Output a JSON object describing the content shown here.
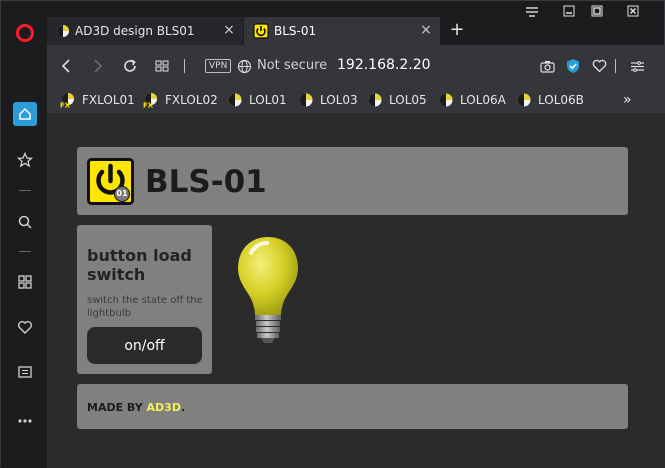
{
  "tabs": [
    {
      "title": "AD3D design BLS01",
      "active": false
    },
    {
      "title": "BLS-01",
      "active": true
    }
  ],
  "address_bar": {
    "vpn_label": "VPN",
    "security_text": "Not secure",
    "url": "192.168.2.20"
  },
  "bookmarks": [
    {
      "label": "FXLOL01",
      "icon": "fx-favicon"
    },
    {
      "label": "FXLOL02",
      "icon": "fx-favicon"
    },
    {
      "label": "LOL01",
      "icon": "lol-favicon"
    },
    {
      "label": "LOL03",
      "icon": "lol-favicon"
    },
    {
      "label": "LOL05",
      "icon": "lol-favicon"
    },
    {
      "label": "LOL06A",
      "icon": "lol-favicon"
    },
    {
      "label": "LOL06B",
      "icon": "lol-favicon"
    }
  ],
  "page": {
    "title": "BLS-01",
    "logo_badge": "01",
    "switch_card": {
      "title": "button load switch",
      "description": "switch the state off the lightbulb",
      "button_label": "on/off"
    },
    "footer": {
      "prefix": "MADE BY ",
      "brand": "AD3D",
      "suffix": "."
    }
  },
  "colors": {
    "accent_yellow": "#ffe600",
    "brand_yellow": "#f5f05a",
    "card_gray": "#808080",
    "page_bg": "#2b2b2b",
    "opera_red": "#ff1b2d",
    "shield_blue": "#2d9cdb"
  },
  "lightbulb_state": "on"
}
